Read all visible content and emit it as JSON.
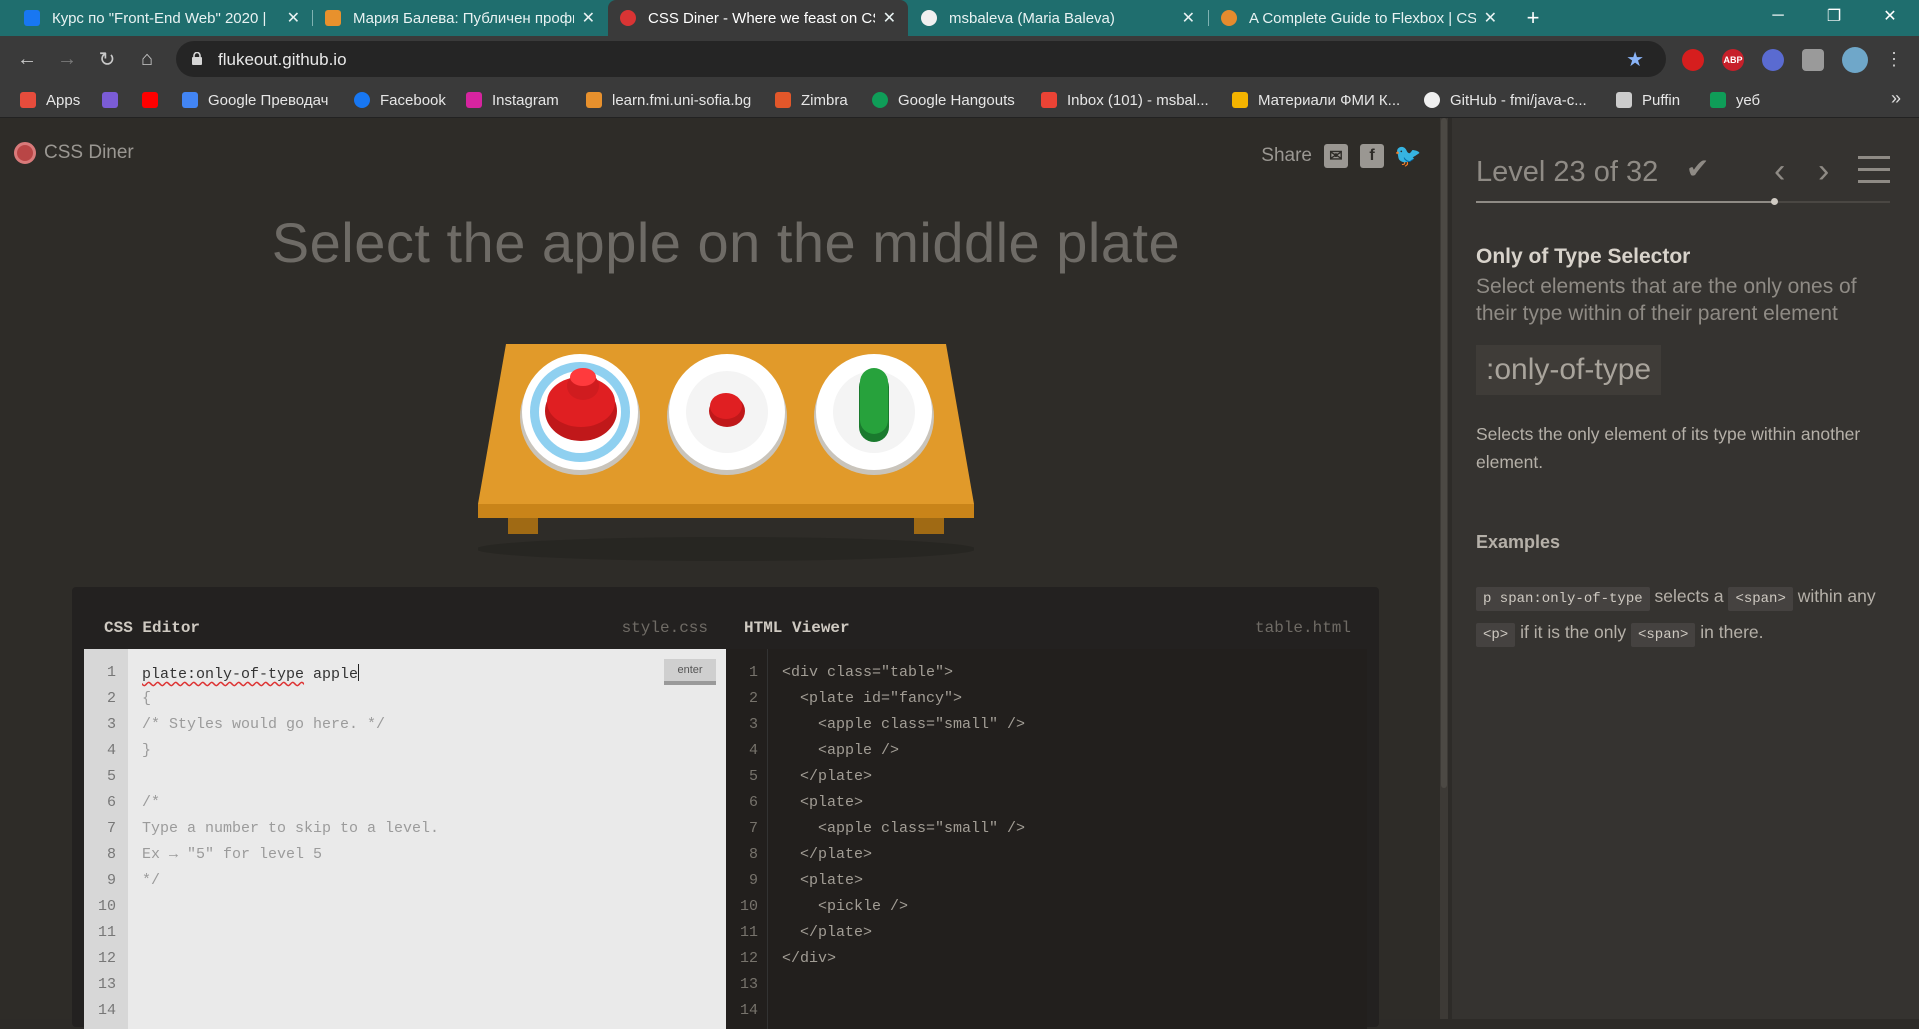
{
  "browser": {
    "tabs": [
      {
        "title": "Курс по \"Front-End Web\" 2020 |",
        "favicon_color": "#1877f2",
        "active": false
      },
      {
        "title": "Мария Балева: Публичен профи",
        "favicon_color": "#e8912d",
        "active": false
      },
      {
        "title": "CSS Diner - Where we feast on CS",
        "favicon_color": "#d93434",
        "active": true
      },
      {
        "title": "msbaleva (Maria Baleva)",
        "favicon_color": "#f0f0f0",
        "active": false
      },
      {
        "title": "A Complete Guide to Flexbox | CS",
        "favicon_color": "#e58b2e",
        "active": false
      }
    ],
    "close_glyph": "✕",
    "new_tab_glyph": "+",
    "url": "flukeout.github.io",
    "window_controls": {
      "minimize": "─",
      "maximize": "❐",
      "close": "✕"
    },
    "nav": {
      "back": "←",
      "forward": "→",
      "reload": "↻",
      "home": "⌂"
    },
    "extensions": [
      {
        "name": "stop-extension-icon",
        "label": "",
        "color": "#d61e1e"
      },
      {
        "name": "adblock-icon",
        "label": "ABP",
        "color": "#c7202a"
      },
      {
        "name": "blocker-icon",
        "label": "",
        "color": "#5a6bd1"
      },
      {
        "name": "puzzle-extensions-icon",
        "label": "",
        "color": "#9a9a9a"
      },
      {
        "name": "profile-avatar",
        "label": "",
        "color": "#6fa7c9"
      }
    ],
    "bookmarks": [
      {
        "label": "Apps",
        "color": "#e74c3c"
      },
      {
        "label": "",
        "color": "#7b5cd6"
      },
      {
        "label": "",
        "color": "#ff0000"
      },
      {
        "label": "Google Преводач",
        "color": "#4285f4"
      },
      {
        "label": "Facebook",
        "color": "#1877f2"
      },
      {
        "label": "Instagram",
        "color": "#d6249f"
      },
      {
        "label": "learn.fmi.uni-sofia.bg",
        "color": "#e8912d"
      },
      {
        "label": "Zimbra",
        "color": "#e2572a"
      },
      {
        "label": "Google Hangouts",
        "color": "#0f9d58"
      },
      {
        "label": "Inbox (101) - msbal...",
        "color": "#ea4335"
      },
      {
        "label": "Материали ФМИ К...",
        "color": "#f4b400"
      },
      {
        "label": "GitHub - fmi/java-c...",
        "color": "#f0f0f0"
      },
      {
        "label": "Puffin",
        "color": "#cccccc"
      },
      {
        "label": "уеб",
        "color": "#0f9d58"
      }
    ],
    "bookmarks_more": "»"
  },
  "game": {
    "logo_text": "CSS Diner",
    "share_label": "Share",
    "order": "Select the apple on the middle plate",
    "css_editor": {
      "title": "CSS Editor",
      "filename": "style.css",
      "input_value": "plate:only-of-type apple",
      "input_first": "plate:only-of-type",
      "input_rest": " apple",
      "enter_label": "enter",
      "lines": [
        "{",
        "/* Styles would go here. */",
        "}",
        "",
        "/*",
        "Type a number to skip to a level.",
        "Ex → \"5\" for level 5",
        "*/",
        "",
        "",
        "",
        ""
      ],
      "line_numbers": [
        "1",
        "2",
        "3",
        "4",
        "5",
        "6",
        "7",
        "8",
        "9",
        "10",
        "11",
        "12",
        "13",
        "14"
      ]
    },
    "html_viewer": {
      "title": "HTML Viewer",
      "filename": "table.html",
      "lines": [
        "<div class=\"table\">",
        "  <plate id=\"fancy\">",
        "    <apple class=\"small\" />",
        "    <apple />",
        "  </plate>",
        "  <plate>",
        "    <apple class=\"small\" />",
        "  </plate>",
        "  <plate>",
        "    <pickle />",
        "  </plate>",
        "</div>",
        "",
        ""
      ],
      "line_numbers": [
        "1",
        "2",
        "3",
        "4",
        "5",
        "6",
        "7",
        "8",
        "9",
        "10",
        "11",
        "12",
        "13",
        "14"
      ]
    }
  },
  "sidebar": {
    "level_text": "Level 23 of 32",
    "level_current": 23,
    "level_total": 32,
    "check_glyph": "✔",
    "prev_glyph": "‹",
    "next_glyph": "›",
    "selector_name": "Only of Type Selector",
    "selector_subtitle": "Select elements that are the only ones of their type within of their parent element",
    "syntax": ":only-of-type",
    "hint": "Selects the only element of its type within another element.",
    "examples_heading": "Examples",
    "example": {
      "code1": "p span:only-of-type",
      "text1": "selects a",
      "code2": "<span>",
      "text2": "within any",
      "code3": "<p>",
      "text3": "if it is the only",
      "code4": "<span>",
      "text4": "in there."
    }
  }
}
